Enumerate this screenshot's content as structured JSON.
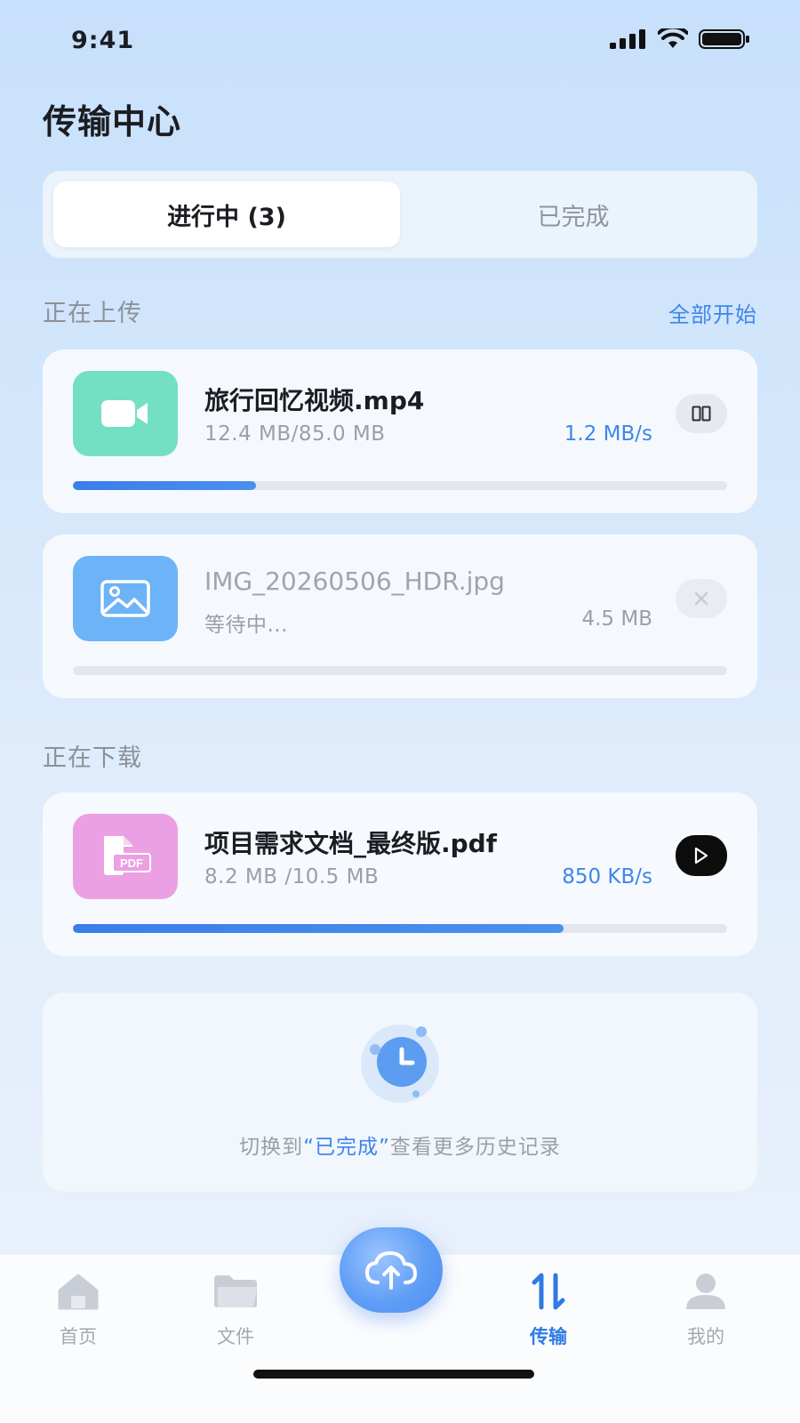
{
  "status_bar": {
    "time": "9:41"
  },
  "page": {
    "title": "传输中心"
  },
  "segments": {
    "active": "进行中 (3)",
    "inactive": "已完成"
  },
  "uploading": {
    "label": "正在上传",
    "action": "全部开始",
    "items": [
      {
        "name": "旅行回忆视频.mp4",
        "size": "12.4 MB/85.0 MB",
        "speed": "1.2 MB/s",
        "progress": 0.28,
        "icon": "video-camera-icon",
        "color": "#73e0c3",
        "control": "pause"
      },
      {
        "name": "IMG_20260506_HDR.jpg",
        "size": "等待中...",
        "speed": "4.5 MB",
        "progress": 0.0,
        "icon": "image-icon",
        "color": "#6cb3f8",
        "control": "close"
      }
    ]
  },
  "downloading": {
    "label": "正在下载",
    "items": [
      {
        "name": "项目需求文档_最终版.pdf",
        "size": "8.2 MB /10.5 MB",
        "speed": "850 KB/s",
        "progress": 0.75,
        "icon": "pdf-file-icon",
        "icon_text": "PDF",
        "color": "#eca0e4",
        "control": "play"
      }
    ]
  },
  "history": {
    "text_before": "切换到",
    "text_highlight": "“已完成”",
    "text_after": "查看更多历史记录"
  },
  "tabbar": {
    "home": "首页",
    "files": "文件",
    "transfer": "传输",
    "mine": "我的",
    "active": "transfer"
  },
  "colors": {
    "accent": "#3f86e8",
    "progress": "#3a7ee8"
  }
}
